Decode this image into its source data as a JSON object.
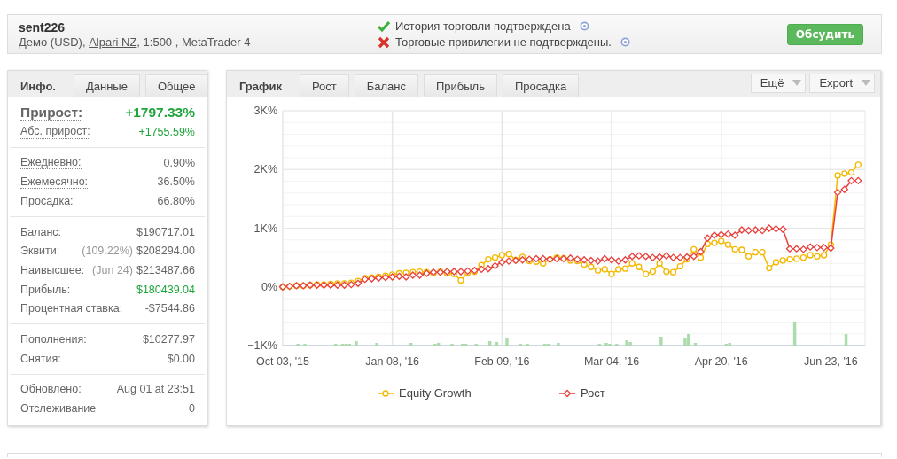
{
  "header": {
    "title": "sent226",
    "subtitle": {
      "before": "Демо (USD), ",
      "link": "Alpari NZ",
      "after": ", 1:500 , MetaTrader 4"
    },
    "statuses": [
      {
        "text": "История торговли подтверждена",
        "verified": true
      },
      {
        "text": "Торговые привилегии не подтверждены.",
        "verified": false
      }
    ],
    "button": "Обсудить"
  },
  "info_panel": {
    "tabs": [
      {
        "label": "Инфо.",
        "selected": true
      },
      {
        "label": "Данные",
        "selected": false
      },
      {
        "label": "Общее",
        "selected": false
      }
    ],
    "sections": [
      [
        {
          "kind": "headline",
          "label": "Прирост:",
          "value": "+1797.33%",
          "underlined": true,
          "highlight": true
        },
        {
          "kind": "row",
          "label": "Абс. прирост:",
          "value": "+1755.59%",
          "underlined": true,
          "highlight": true
        }
      ],
      [
        {
          "kind": "row",
          "label": "Ежедневно:",
          "value": "0.90%",
          "underlined": true,
          "highlight": false
        },
        {
          "kind": "row",
          "label": "Ежемесячно:",
          "value": "36.50%",
          "underlined": true,
          "highlight": false
        },
        {
          "kind": "row",
          "label": "Просадка:",
          "value": "66.80%",
          "underlined": false,
          "highlight": false
        }
      ],
      [
        {
          "kind": "row",
          "label": "Баланс:",
          "value": "$190717.01",
          "underlined": false,
          "highlight": false
        },
        {
          "kind": "row",
          "label": "Эквити:",
          "note": "(109.22%)",
          "value": "$208294.00",
          "underlined": false,
          "highlight": false
        },
        {
          "kind": "row",
          "label": "Наивысшее:",
          "note": "(Jun 24)",
          "value": "$213487.66",
          "underlined": false,
          "highlight": false
        },
        {
          "kind": "row",
          "label": "Прибыль:",
          "value": "$180439.04",
          "underlined": false,
          "highlight": true
        },
        {
          "kind": "row",
          "label": "Процентная ставка:",
          "value": "-$7544.86",
          "underlined": false,
          "highlight": false
        }
      ],
      [
        {
          "kind": "row",
          "label": "Пополнения:",
          "value": "$10277.97",
          "underlined": false,
          "highlight": false
        },
        {
          "kind": "row",
          "label": "Снятия:",
          "value": "$0.00",
          "underlined": false,
          "highlight": false
        }
      ],
      [
        {
          "kind": "row",
          "label": "Обновлено:",
          "value": "Aug 01 at 23:51",
          "underlined": false,
          "highlight": false
        },
        {
          "kind": "row",
          "label": "Отслеживание",
          "value": "0",
          "underlined": false,
          "highlight": false
        }
      ]
    ]
  },
  "chart_panel": {
    "tabs": [
      {
        "label": "График",
        "selected": true
      },
      {
        "label": "Рост",
        "selected": false
      },
      {
        "label": "Баланс",
        "selected": false
      },
      {
        "label": "Прибыль",
        "selected": false
      },
      {
        "label": "Просадка",
        "selected": false
      }
    ],
    "dropdowns": [
      "Ещё",
      "Export"
    ],
    "chart_data": {
      "type": "line",
      "grid": true,
      "legend": true,
      "ylim": [
        -1000,
        3000
      ],
      "categories": [
        "Oct 03, '15",
        null,
        null,
        null,
        null,
        null,
        null,
        null,
        null,
        null,
        null,
        null,
        null,
        null,
        null,
        null,
        "Jan 08, '16",
        null,
        null,
        null,
        null,
        null,
        null,
        null,
        null,
        null,
        null,
        null,
        null,
        null,
        null,
        null,
        "Feb 09, '16",
        null,
        null,
        null,
        null,
        null,
        null,
        null,
        null,
        null,
        null,
        null,
        null,
        null,
        null,
        null,
        "Mar 04, '16",
        null,
        null,
        null,
        null,
        null,
        null,
        null,
        null,
        null,
        null,
        null,
        null,
        null,
        null,
        null,
        "Apr 20, '16",
        null,
        null,
        null,
        null,
        null,
        null,
        null,
        null,
        null,
        null,
        null,
        null,
        null,
        null,
        null,
        "Jun 23, '16",
        null,
        null,
        null,
        null
      ],
      "yticks": [
        {
          "value": 3000,
          "label": "3K%"
        },
        {
          "value": 2000,
          "label": "2K%"
        },
        {
          "value": 1000,
          "label": "1K%"
        },
        {
          "value": 0,
          "label": "0%"
        },
        {
          "value": -1000,
          "label": "−1K%"
        }
      ],
      "series": [
        {
          "name": "Equity Growth",
          "color": "#f5b800",
          "marker": "circle",
          "values": [
            0,
            10,
            20,
            20,
            30,
            40,
            40,
            50,
            60,
            60,
            70,
            100,
            150,
            160,
            170,
            190,
            210,
            230,
            240,
            250,
            260,
            250,
            230,
            260,
            230,
            220,
            110,
            240,
            260,
            370,
            470,
            500,
            540,
            560,
            460,
            510,
            440,
            430,
            400,
            470,
            500,
            490,
            450,
            440,
            380,
            340,
            280,
            300,
            220,
            300,
            310,
            400,
            340,
            220,
            260,
            400,
            260,
            250,
            350,
            470,
            640,
            500,
            730,
            750,
            780,
            720,
            640,
            630,
            520,
            590,
            590,
            320,
            420,
            450,
            470,
            480,
            500,
            540,
            520,
            540,
            720,
            1900,
            1930,
            1950,
            2080
          ]
        },
        {
          "name": "Рост",
          "color": "#e8413c",
          "marker": "diamond",
          "values": [
            0,
            10,
            20,
            20,
            30,
            30,
            30,
            30,
            30,
            30,
            40,
            60,
            130,
            140,
            150,
            160,
            170,
            180,
            170,
            200,
            200,
            230,
            250,
            250,
            260,
            260,
            260,
            270,
            280,
            300,
            310,
            360,
            420,
            440,
            450,
            460,
            470,
            480,
            480,
            470,
            480,
            480,
            490,
            470,
            460,
            450,
            440,
            480,
            460,
            440,
            460,
            520,
            530,
            520,
            500,
            510,
            530,
            500,
            500,
            510,
            520,
            600,
            830,
            880,
            890,
            900,
            880,
            970,
            960,
            970,
            960,
            1000,
            990,
            980,
            650,
            650,
            640,
            680,
            670,
            670,
            660,
            1610,
            1660,
            1810,
            1810
          ]
        }
      ]
    }
  }
}
